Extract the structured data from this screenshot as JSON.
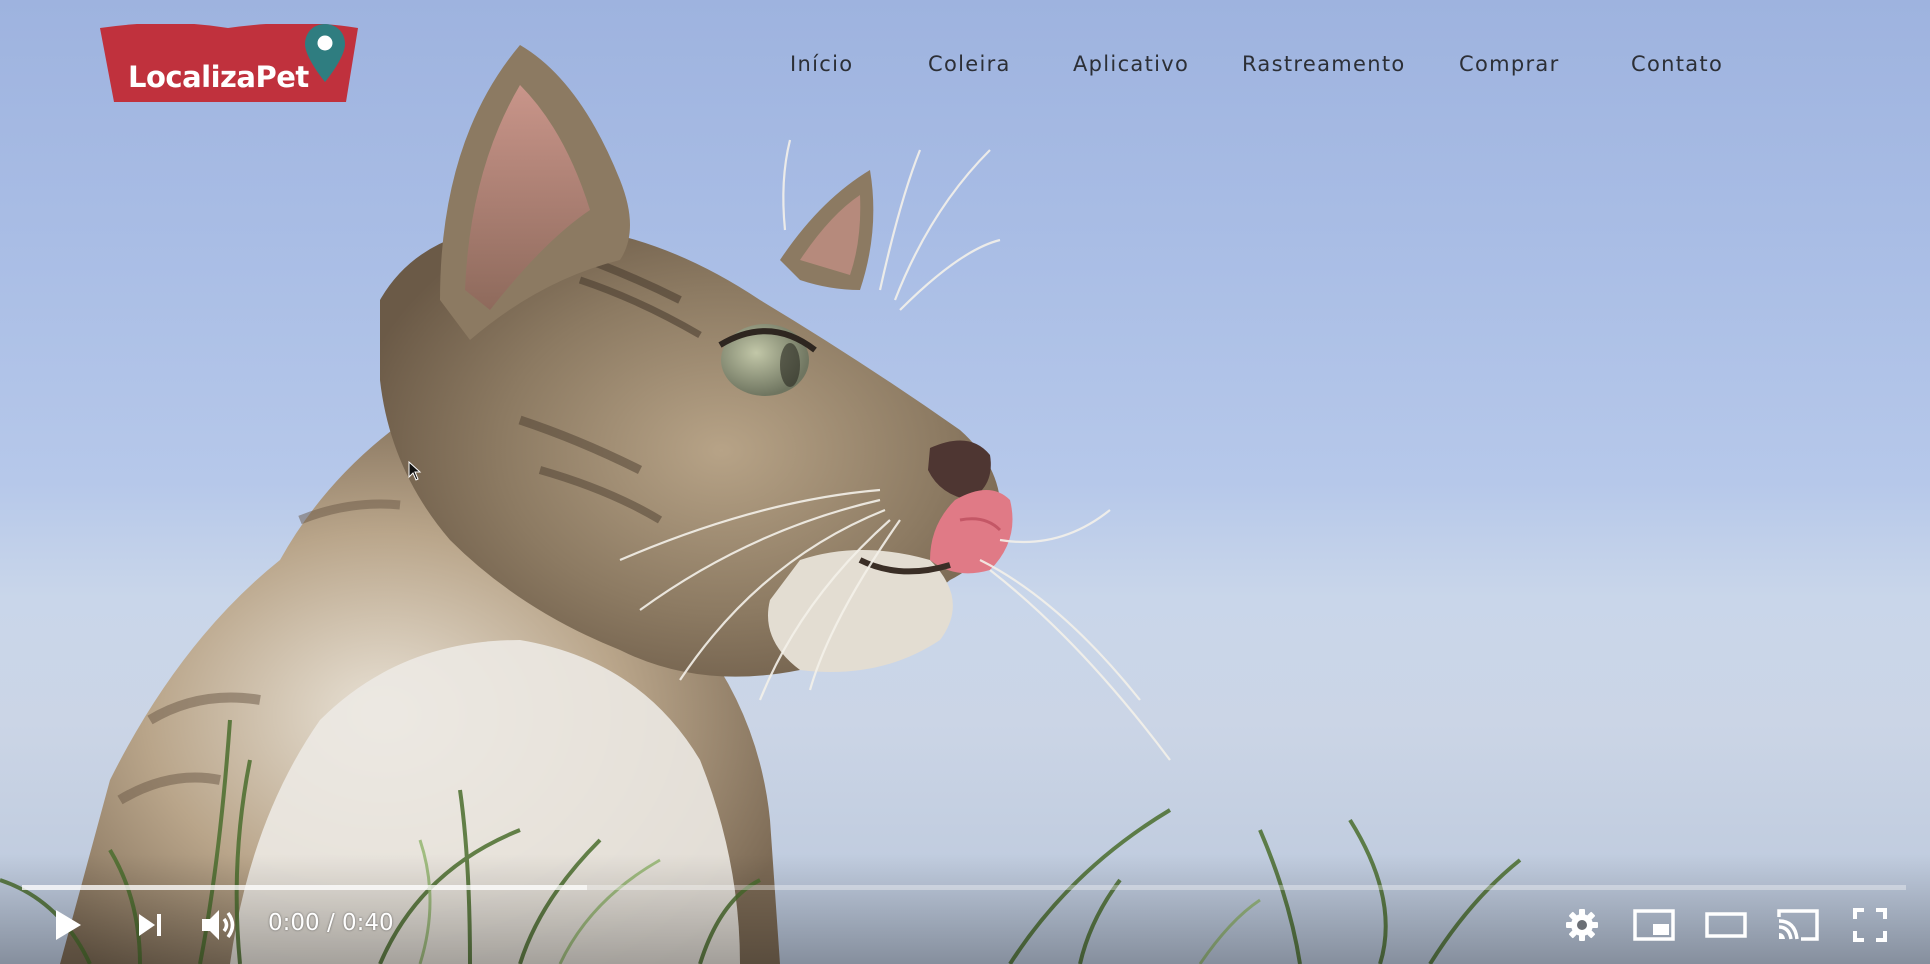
{
  "site": {
    "logo_text": "LocalizaPet",
    "nav": [
      {
        "label": "Início"
      },
      {
        "label": "Coleira"
      },
      {
        "label": "Aplicativo"
      },
      {
        "label": "Rastreamento"
      },
      {
        "label": "Comprar"
      },
      {
        "label": "Contato"
      }
    ]
  },
  "player": {
    "time_display": "0:00 / 0:40",
    "current_time": "0:00",
    "duration": "0:40",
    "progress_played_fraction": 0.0,
    "progress_buffered_fraction": 0.3
  },
  "icons": {
    "play": "play-icon",
    "next": "next-icon",
    "volume": "volume-icon",
    "settings": "gear-icon",
    "miniplayer": "miniplayer-icon",
    "theater": "theater-mode-icon",
    "cast": "cast-icon",
    "fullscreen": "fullscreen-icon",
    "location_pin": "location-pin-icon"
  },
  "colors": {
    "logo_red": "#c0313d",
    "pin_teal": "#2f7d80",
    "progress_red": "#ff0000"
  }
}
